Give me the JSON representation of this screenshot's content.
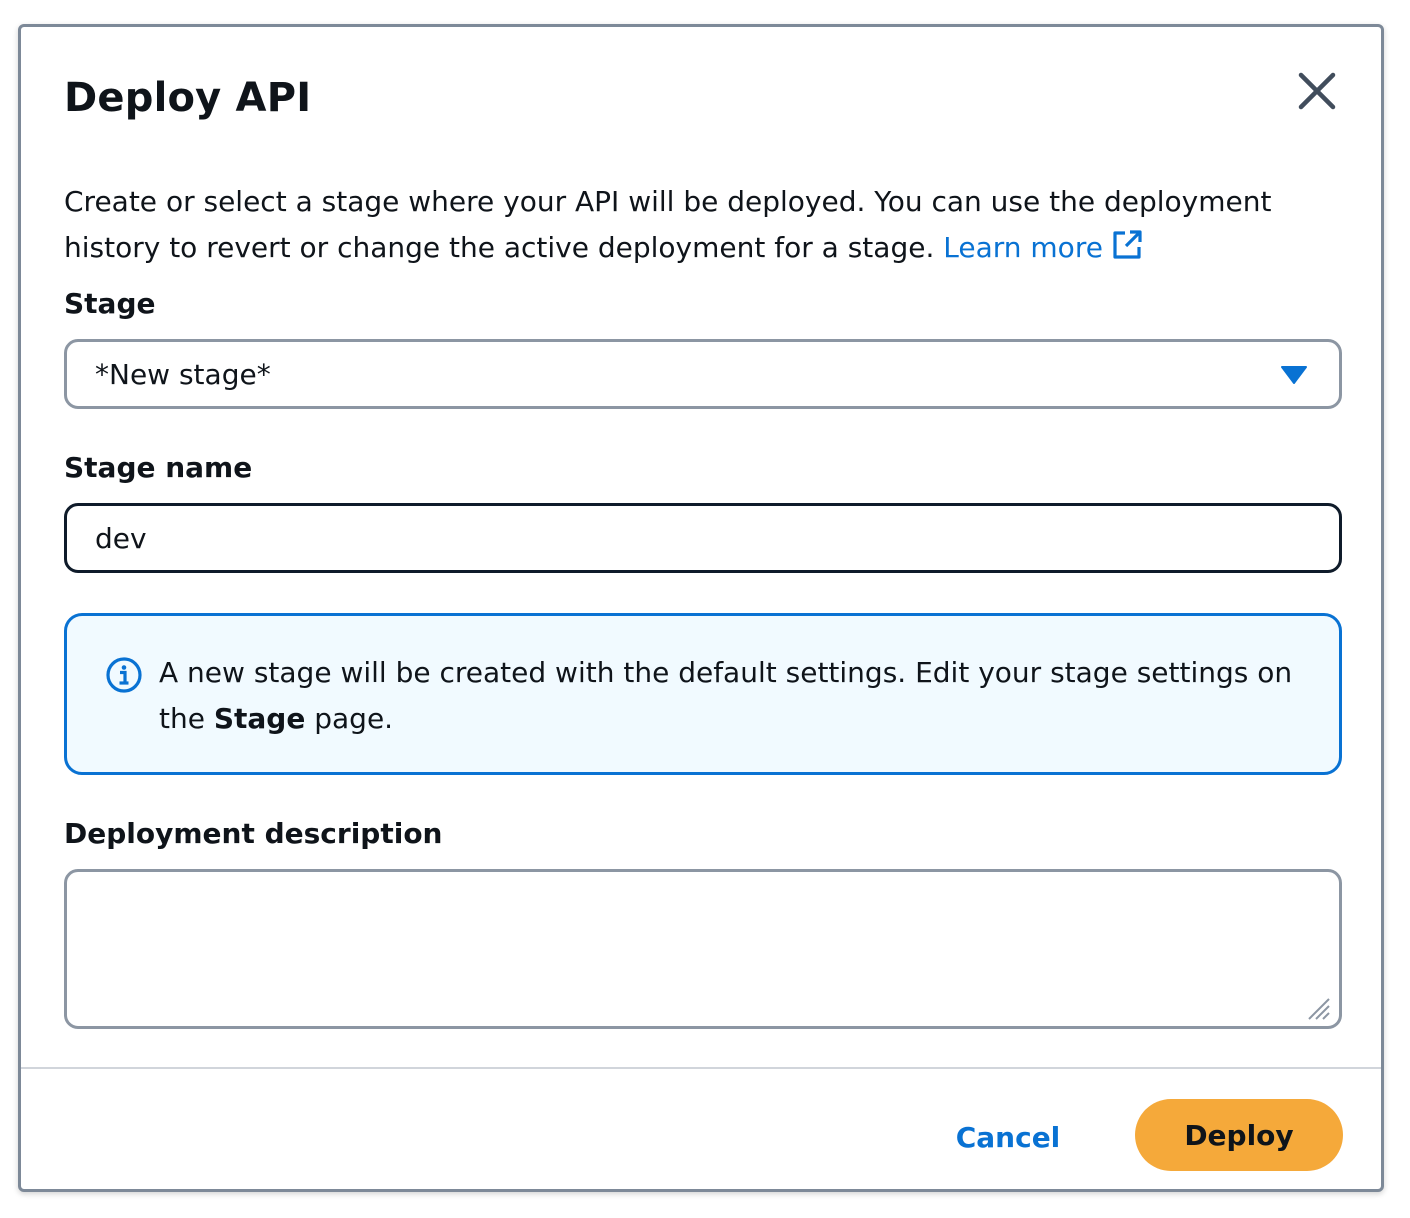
{
  "dialog": {
    "title": "Deploy API",
    "description": "Create or select a stage where your API will be deployed. You can use the deployment history to revert or change the active deployment for a stage.",
    "learn_more": "Learn more",
    "close_icon": "close-icon",
    "external_icon": "external-link-icon"
  },
  "stage": {
    "label": "Stage",
    "selected": "*New stage*",
    "caret_icon": "caret-down-icon"
  },
  "stage_name": {
    "label": "Stage name",
    "value": "dev"
  },
  "alert": {
    "icon": "info-icon",
    "text_before": "A new stage will be created with the default settings. Edit your stage settings on the",
    "bold": "Stage",
    "text_after": "page."
  },
  "deployment_description": {
    "label": "Deployment description",
    "value": ""
  },
  "footer": {
    "cancel_label": "Cancel",
    "deploy_label": "Deploy"
  },
  "colors": {
    "link": "#0972d3",
    "primary_button": "#f5a93a",
    "alert_background": "#f1faff",
    "alert_border": "#0972d3",
    "text": "#0f141a"
  }
}
